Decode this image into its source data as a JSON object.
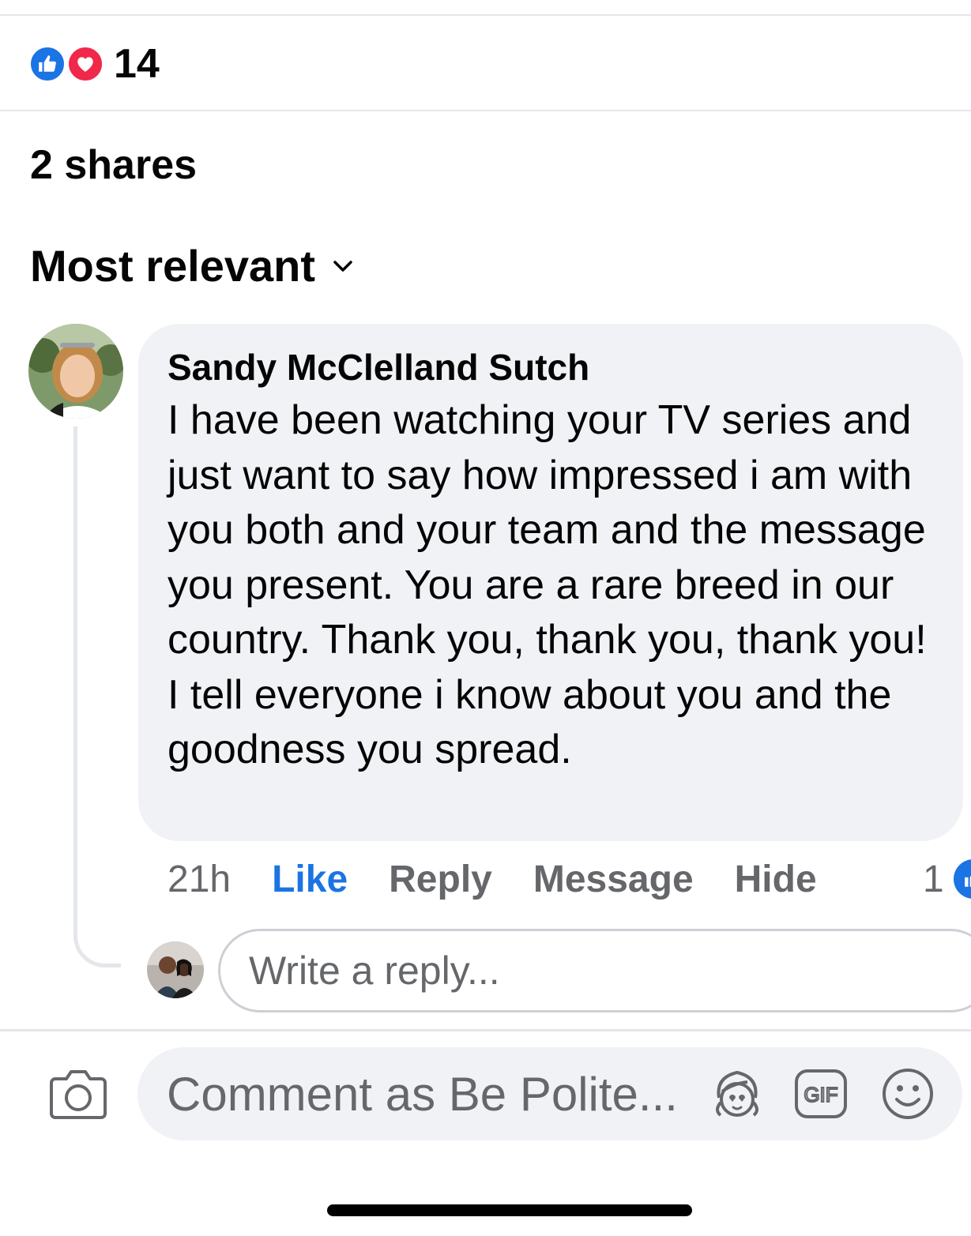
{
  "reactions": {
    "count": "14",
    "types": [
      "like",
      "love"
    ],
    "colors": {
      "like": "#1b74e4",
      "love": "#f02849"
    }
  },
  "shares": {
    "label": "2 shares"
  },
  "sort": {
    "label": "Most relevant"
  },
  "comment": {
    "author": "Sandy McClelland Sutch",
    "text": "I have been watching your TV series and just want to say how impressed i am with you both and your team and the message you present. You are a rare breed in our country. Thank you, thank you, thank you! I tell everyone i know about you and the goodness you spread.",
    "time": "21h",
    "actions": {
      "like": "Like",
      "reply": "Reply",
      "message": "Message",
      "hide": "Hide"
    },
    "like_state": "liked",
    "reaction_count": "1"
  },
  "reply_input": {
    "placeholder": "Write a reply..."
  },
  "composer": {
    "placeholder": "Comment as Be Polite...",
    "icons": [
      "camera-icon",
      "avatar-sticker-icon",
      "gif-icon",
      "emoji-icon"
    ],
    "gif_label": "GIF"
  },
  "colors": {
    "accent": "#1b74e4",
    "bubble": "#f0f2f5",
    "secondary_text": "#65676b"
  }
}
